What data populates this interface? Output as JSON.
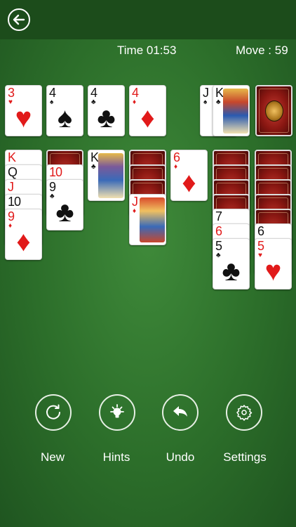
{
  "header": {
    "time_label": "Time 01:53",
    "move_label": "Move : 59"
  },
  "icons": {
    "back": "arrow-left-icon",
    "new": "refresh-icon",
    "hints": "lightbulb-icon",
    "undo": "undo-arrow-icon",
    "settings": "gear-icon"
  },
  "foundation": [
    {
      "rank": "3",
      "suit": "♥"
    },
    {
      "rank": "4",
      "suit": "♠"
    },
    {
      "rank": "4",
      "suit": "♣"
    },
    {
      "rank": "4",
      "suit": "♦"
    }
  ],
  "waste": [
    {
      "rank": "J",
      "suit": "♠"
    },
    {
      "rank": "K",
      "suit": "♣"
    }
  ],
  "tableau": {
    "col1": [
      {
        "rank": "K",
        "suit": "♥"
      },
      {
        "rank": "Q",
        "suit": "♠"
      },
      {
        "rank": "J",
        "suit": "♥"
      },
      {
        "rank": "10",
        "suit": "♠"
      },
      {
        "rank": "9",
        "suit": "♦"
      }
    ],
    "col2": [
      {
        "rank": "10",
        "suit": "♥"
      },
      {
        "rank": "9",
        "suit": "♣"
      }
    ],
    "col3": [
      {
        "rank": "K",
        "suit": "♣"
      }
    ],
    "col4": [
      {
        "rank": "J",
        "suit": "♦"
      }
    ],
    "col5": [
      {
        "rank": "6",
        "suit": "♦"
      }
    ],
    "col6": [
      {
        "rank": "7",
        "suit": "♠"
      },
      {
        "rank": "6",
        "suit": "♥"
      },
      {
        "rank": "5",
        "suit": "♣"
      }
    ],
    "col7": [
      {
        "rank": "6",
        "suit": "♠"
      },
      {
        "rank": "5",
        "suit": "♥"
      }
    ]
  },
  "toolbar": {
    "new_label": "New",
    "hints_label": "Hints",
    "undo_label": "Undo",
    "settings_label": "Settings"
  },
  "colors": {
    "felt": "#2c6e2a",
    "topbar": "#1c4c1b",
    "red_suit": "#e11a1a",
    "black_suit": "#111111",
    "card_back": "#8a1712"
  }
}
